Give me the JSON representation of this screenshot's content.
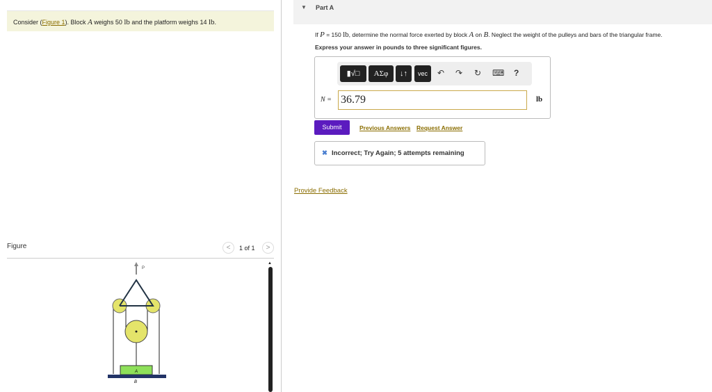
{
  "statement": {
    "prefix": "Consider (",
    "figure_link": "Figure 1",
    "middle": "). Block ",
    "block": "A",
    "weighs": " weighs 50 ",
    "unit": "lb",
    "rest": " and the platform weighs 14 ",
    "end": "."
  },
  "figure": {
    "label": "Figure",
    "pagination": "1 of 1",
    "prev": "<",
    "next": ">",
    "labels": {
      "P": "P",
      "A": "A",
      "B": "B"
    }
  },
  "part": {
    "title": "Part A",
    "question": {
      "a": "If ",
      "P": "P",
      "b": " = 150 ",
      "unit": "lb",
      "c": ", determine the normal force exerted by block ",
      "A": "A",
      "d": " on ",
      "B": "B",
      "e": ". Neglect the weight of the pulleys and bars of the triangular frame."
    },
    "instruction": "Express your answer in pounds to three significant figures."
  },
  "toolbar": {
    "templates": "▮√□",
    "greek": "AΣφ",
    "arrows": "↓↑",
    "vec": "vec",
    "undo": "↶",
    "redo": "↷",
    "reset": "↻",
    "keyboard": "⌨",
    "help": "?"
  },
  "answer": {
    "label": "N =",
    "value": "36.79",
    "unit": "lb"
  },
  "actions": {
    "submit": "Submit",
    "previous": "Previous Answers",
    "request": "Request Answer"
  },
  "feedback": {
    "icon": "✖",
    "text": "Incorrect; Try Again; 5 attempts remaining"
  },
  "provide_feedback": "Provide Feedback",
  "colors": {
    "submit": "#5b1bbf",
    "link": "#8a6d00",
    "statement_bg": "#f4f4dc"
  }
}
